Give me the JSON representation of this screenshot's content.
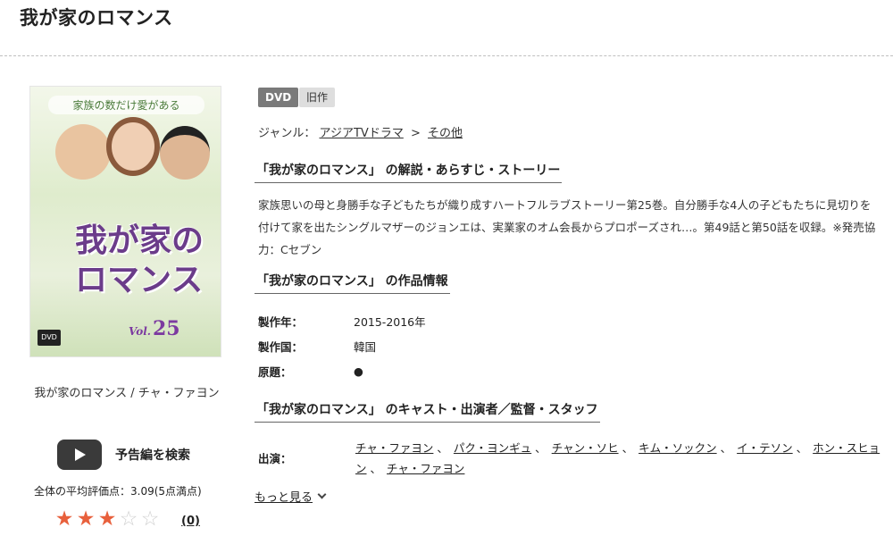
{
  "page": {
    "title": "我が家のロマンス"
  },
  "cover": {
    "tagline": "家族の数だけ愛がある",
    "title_line1": "我が家の",
    "title_line2": "ロマンス",
    "vol_prefix": "Vol.",
    "vol_number": "25",
    "dvd_logo": "DVD"
  },
  "cover_caption": "我が家のロマンス / チャ・ファヨン",
  "trailer": {
    "label": "予告編を検索",
    "icon": "play-icon"
  },
  "rating": {
    "average_text": "全体の平均評価点：3.09(5点満点)",
    "stars_filled": 3,
    "stars_total": 5,
    "review_count": "(0)",
    "color_on": "#e8603c"
  },
  "badges": {
    "format": "DVD",
    "status": "旧作"
  },
  "genre": {
    "label": "ジャンル：",
    "path": [
      "アジアTVドラマ",
      "その他"
    ],
    "separator": ">"
  },
  "sections": {
    "synopsis_heading": "「我が家のロマンス」 の解説・あらすじ・ストーリー",
    "info_heading": "「我が家のロマンス」 の作品情報",
    "cast_heading": "「我が家のロマンス」 のキャスト・出演者／監督・スタッフ"
  },
  "synopsis": "家族思いの母と身勝手な子どもたちが織り成すハートフルラブストーリー第25巻。自分勝手な4人の子どもたちに見切りを付けて家を出たシングルマザーのジョンエは、実業家のオム会長からプロポーズされ…。第49話と第50話を収録。※発売協力：Cセブン",
  "info": [
    {
      "label": "製作年：",
      "value": "2015-2016年"
    },
    {
      "label": "製作国：",
      "value": "韓国"
    },
    {
      "label": "原題：",
      "value": "●"
    }
  ],
  "cast": {
    "label": "出演：",
    "names": [
      "チャ・ファヨン",
      "パク・ヨンギュ",
      "チャン・ソヒ",
      "キム・ソックン",
      "イ・テソン",
      "ホン・スヒョン",
      "チャ・ファヨン"
    ],
    "separator": "、"
  },
  "more": {
    "label": "もっと見る"
  }
}
